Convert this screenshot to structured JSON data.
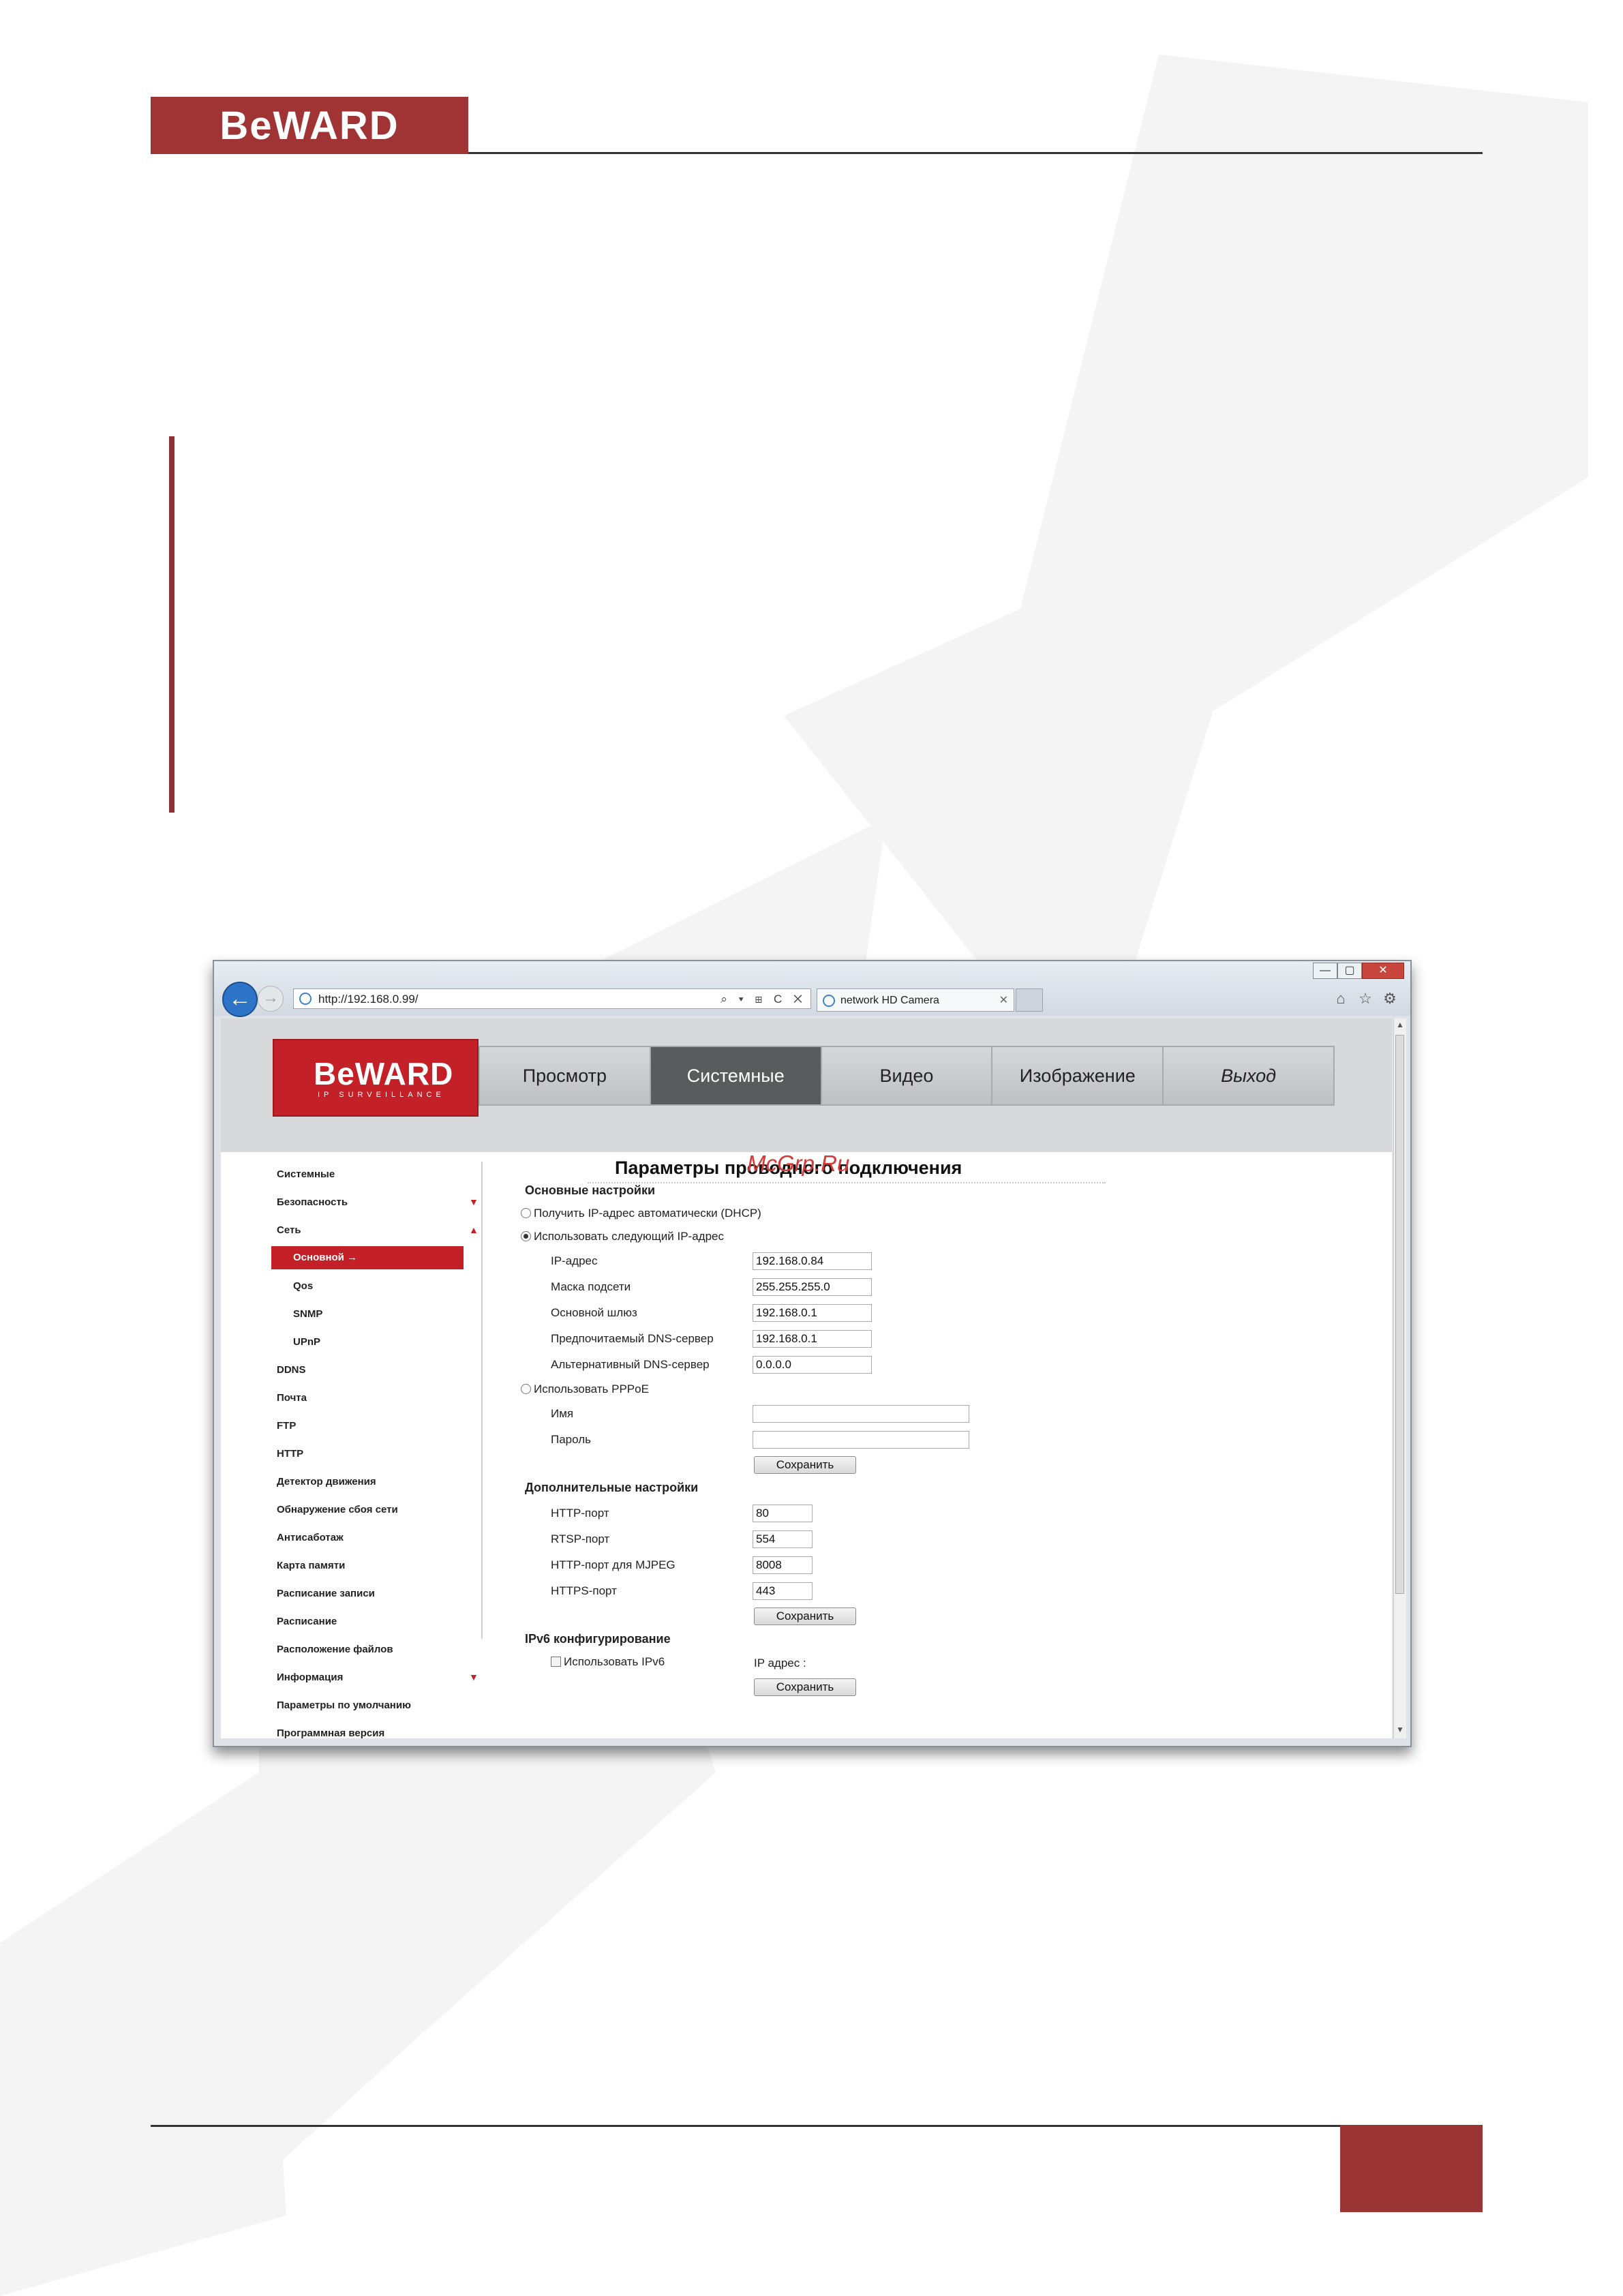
{
  "document": {
    "logo_text": "BeWARD",
    "colors": {
      "brand": "#a03434",
      "accent": "#c32027",
      "footer_box": "#9b3535"
    }
  },
  "browser": {
    "address": "http://192.168.0.99/",
    "address_tools": "⌕ ▾ ⊞ C ✕",
    "tab_title": "network HD Camera",
    "tab_close": "✕",
    "back_icon": "←",
    "forward_icon": "→",
    "window_controls": {
      "minimize": "—",
      "maximize": "▢",
      "close": "✕"
    },
    "toolbar_icons": {
      "home": "⌂",
      "favorites": "☆",
      "settings": "⚙"
    }
  },
  "camera": {
    "logo": {
      "brand": "BeWARD",
      "tagline": "IP SURVEILLANCE"
    },
    "menu": [
      "Просмотр",
      "Системные",
      "Видео",
      "Изображение",
      "Выход"
    ],
    "menu_active": "Системные",
    "sidebar": [
      {
        "label": "Системные"
      },
      {
        "label": "Безопасность",
        "arrow": "▼"
      },
      {
        "label": "Сеть",
        "arrow": "▲"
      },
      {
        "label": "Основной →"
      },
      {
        "label": "Qos"
      },
      {
        "label": "SNMP"
      },
      {
        "label": "UPnP"
      },
      {
        "label": "DDNS"
      },
      {
        "label": "Почта"
      },
      {
        "label": "FTP"
      },
      {
        "label": "HTTP"
      },
      {
        "label": "Детектор движения"
      },
      {
        "label": "Обнаружение сбоя сети"
      },
      {
        "label": "Антисаботаж"
      },
      {
        "label": "Карта памяти"
      },
      {
        "label": "Расписание записи"
      },
      {
        "label": "Расписание"
      },
      {
        "label": "Расположение файлов"
      },
      {
        "label": "Информация",
        "arrow": "▼"
      },
      {
        "label": "Параметры по умолчанию"
      },
      {
        "label": "Программная версия"
      }
    ],
    "page_title": "Параметры проводного подключения",
    "overlay_text": "McGrp.Ru",
    "basic": {
      "title": "Основные настройки",
      "dhcp_label": "Получить IP-адрес автоматически (DHCP)",
      "static_label": "Использовать следующий IP-адрес",
      "fields": [
        {
          "label": "IP-адрес",
          "value": "192.168.0.84"
        },
        {
          "label": "Маска подсети",
          "value": "255.255.255.0"
        },
        {
          "label": "Основной шлюз",
          "value": "192.168.0.1"
        },
        {
          "label": "Предпочитаемый DNS-сервер",
          "value": "192.168.0.1"
        },
        {
          "label": "Альтернативный DNS-сервер",
          "value": "0.0.0.0"
        }
      ],
      "pppoe_label": "Использовать PPPoE",
      "pppoe_name_label": "Имя",
      "pppoe_name_value": "",
      "pppoe_password_label": "Пароль",
      "pppoe_password_value": "",
      "save_label": "Сохранить"
    },
    "advanced": {
      "title": "Дополнительные настройки",
      "fields": [
        {
          "label": "HTTP-порт",
          "value": "80"
        },
        {
          "label": "RTSP-порт",
          "value": "554"
        },
        {
          "label": "HTTP-порт для MJPEG",
          "value": "8008"
        },
        {
          "label": "HTTPS-порт",
          "value": "443"
        }
      ],
      "save_label": "Сохранить"
    },
    "ipv6": {
      "title": "IPv6 конфигурирование",
      "use_label": "Использовать IPv6",
      "ip_label": "IP адрес :",
      "save_label": "Сохранить"
    }
  }
}
